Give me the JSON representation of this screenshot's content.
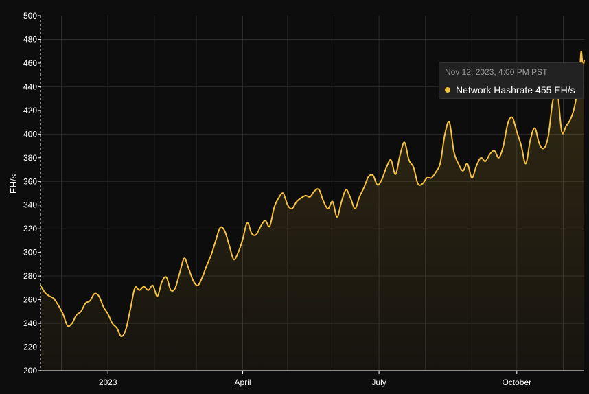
{
  "colors": {
    "background": "#0d0d0d",
    "line": "#f7c23c",
    "grid": "#2a2a2a",
    "text": "#ffffff",
    "tooltip_bg": "#222222",
    "tooltip_muted": "#9a9a9a"
  },
  "tooltip": {
    "date": "Nov 12, 2023, 4:00 PM PST",
    "series_name": "Network Hashrate",
    "value_text": "455 EH/s"
  },
  "chart_data": {
    "type": "area",
    "title": "",
    "xlabel": "",
    "ylabel": "EH/s",
    "ylim": [
      200,
      500
    ],
    "xlim": [
      "2022-11-17",
      "2023-11-15"
    ],
    "grid": true,
    "yticks": [
      200,
      220,
      240,
      260,
      280,
      300,
      320,
      340,
      360,
      380,
      400,
      420,
      440,
      460,
      480,
      500
    ],
    "xticks": [
      {
        "date": "2023-01-01",
        "label": "2023"
      },
      {
        "date": "2023-04-01",
        "label": "April"
      },
      {
        "date": "2023-07-01",
        "label": "July"
      },
      {
        "date": "2023-10-01",
        "label": "October"
      }
    ],
    "series": [
      {
        "name": "Network Hashrate",
        "unit": "EH/s",
        "points": [
          [
            "2022-11-17",
            272
          ],
          [
            "2022-11-20",
            266
          ],
          [
            "2022-11-23",
            263
          ],
          [
            "2022-11-26",
            261
          ],
          [
            "2022-11-29",
            255
          ],
          [
            "2022-12-02",
            248
          ],
          [
            "2022-12-05",
            238
          ],
          [
            "2022-12-08",
            240
          ],
          [
            "2022-12-11",
            247
          ],
          [
            "2022-12-14",
            250
          ],
          [
            "2022-12-17",
            257
          ],
          [
            "2022-12-20",
            259
          ],
          [
            "2022-12-23",
            265
          ],
          [
            "2022-12-26",
            263
          ],
          [
            "2022-12-29",
            254
          ],
          [
            "2023-01-01",
            248
          ],
          [
            "2023-01-04",
            240
          ],
          [
            "2023-01-07",
            236
          ],
          [
            "2023-01-10",
            229
          ],
          [
            "2023-01-13",
            235
          ],
          [
            "2023-01-16",
            252
          ],
          [
            "2023-01-19",
            270
          ],
          [
            "2023-01-22",
            268
          ],
          [
            "2023-01-25",
            271
          ],
          [
            "2023-01-28",
            268
          ],
          [
            "2023-01-31",
            272
          ],
          [
            "2023-02-03",
            263
          ],
          [
            "2023-02-06",
            275
          ],
          [
            "2023-02-09",
            279
          ],
          [
            "2023-02-12",
            268
          ],
          [
            "2023-02-15",
            270
          ],
          [
            "2023-02-18",
            283
          ],
          [
            "2023-02-21",
            295
          ],
          [
            "2023-02-24",
            286
          ],
          [
            "2023-02-27",
            276
          ],
          [
            "2023-03-02",
            272
          ],
          [
            "2023-03-05",
            279
          ],
          [
            "2023-03-08",
            289
          ],
          [
            "2023-03-11",
            298
          ],
          [
            "2023-03-14",
            310
          ],
          [
            "2023-03-17",
            321
          ],
          [
            "2023-03-20",
            318
          ],
          [
            "2023-03-23",
            306
          ],
          [
            "2023-03-26",
            294
          ],
          [
            "2023-03-29",
            300
          ],
          [
            "2023-04-01",
            311
          ],
          [
            "2023-04-04",
            325
          ],
          [
            "2023-04-07",
            316
          ],
          [
            "2023-04-10",
            315
          ],
          [
            "2023-04-13",
            322
          ],
          [
            "2023-04-16",
            327
          ],
          [
            "2023-04-19",
            322
          ],
          [
            "2023-04-22",
            338
          ],
          [
            "2023-04-25",
            346
          ],
          [
            "2023-04-28",
            350
          ],
          [
            "2023-05-01",
            340
          ],
          [
            "2023-05-04",
            337
          ],
          [
            "2023-05-07",
            343
          ],
          [
            "2023-05-10",
            346
          ],
          [
            "2023-05-13",
            348
          ],
          [
            "2023-05-16",
            347
          ],
          [
            "2023-05-19",
            352
          ],
          [
            "2023-05-22",
            353
          ],
          [
            "2023-05-25",
            343
          ],
          [
            "2023-05-28",
            337
          ],
          [
            "2023-05-31",
            343
          ],
          [
            "2023-06-03",
            330
          ],
          [
            "2023-06-06",
            343
          ],
          [
            "2023-06-09",
            353
          ],
          [
            "2023-06-12",
            346
          ],
          [
            "2023-06-15",
            337
          ],
          [
            "2023-06-18",
            347
          ],
          [
            "2023-06-21",
            355
          ],
          [
            "2023-06-24",
            364
          ],
          [
            "2023-06-27",
            365
          ],
          [
            "2023-06-30",
            357
          ],
          [
            "2023-07-03",
            362
          ],
          [
            "2023-07-06",
            372
          ],
          [
            "2023-07-09",
            378
          ],
          [
            "2023-07-12",
            366
          ],
          [
            "2023-07-15",
            382
          ],
          [
            "2023-07-18",
            393
          ],
          [
            "2023-07-21",
            378
          ],
          [
            "2023-07-24",
            372
          ],
          [
            "2023-07-27",
            358
          ],
          [
            "2023-07-30",
            358
          ],
          [
            "2023-08-02",
            363
          ],
          [
            "2023-08-05",
            363
          ],
          [
            "2023-08-08",
            368
          ],
          [
            "2023-08-11",
            376
          ],
          [
            "2023-08-14",
            400
          ],
          [
            "2023-08-17",
            410
          ],
          [
            "2023-08-20",
            385
          ],
          [
            "2023-08-23",
            375
          ],
          [
            "2023-08-26",
            369
          ],
          [
            "2023-08-29",
            375
          ],
          [
            "2023-09-01",
            363
          ],
          [
            "2023-09-04",
            373
          ],
          [
            "2023-09-07",
            380
          ],
          [
            "2023-09-10",
            377
          ],
          [
            "2023-09-13",
            383
          ],
          [
            "2023-09-16",
            386
          ],
          [
            "2023-09-19",
            380
          ],
          [
            "2023-09-22",
            390
          ],
          [
            "2023-09-25",
            409
          ],
          [
            "2023-09-28",
            414
          ],
          [
            "2023-10-01",
            402
          ],
          [
            "2023-10-04",
            390
          ],
          [
            "2023-10-07",
            375
          ],
          [
            "2023-10-10",
            395
          ],
          [
            "2023-10-13",
            405
          ],
          [
            "2023-10-16",
            392
          ],
          [
            "2023-10-19",
            388
          ],
          [
            "2023-10-22",
            398
          ],
          [
            "2023-10-25",
            428
          ],
          [
            "2023-10-28",
            437
          ],
          [
            "2023-10-31",
            402
          ],
          [
            "2023-11-03",
            407
          ],
          [
            "2023-11-06",
            413
          ],
          [
            "2023-11-09",
            426
          ],
          [
            "2023-11-12",
            455
          ],
          [
            "2023-11-13",
            470
          ],
          [
            "2023-11-14",
            458
          ],
          [
            "2023-11-15",
            462
          ]
        ]
      }
    ]
  }
}
